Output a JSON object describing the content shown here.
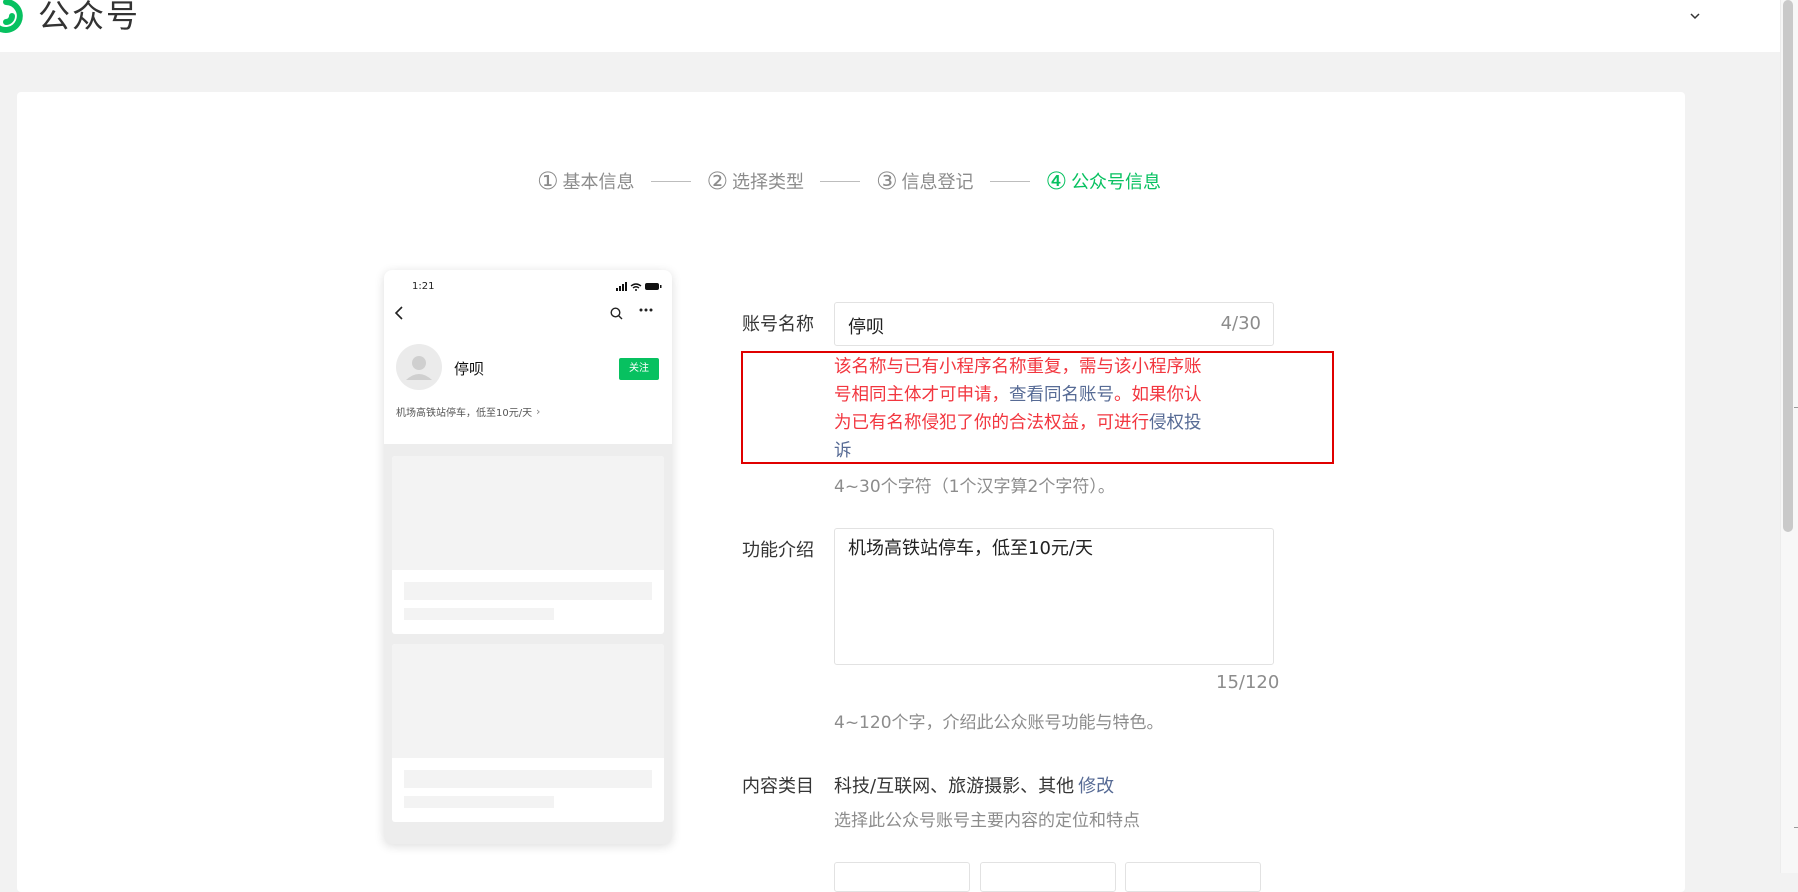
{
  "header": {
    "title": "公众号",
    "brand_color": "#07c160",
    "logo_icon": "wechat-official-account-logo",
    "account_menu_icon": "chevron-down-icon"
  },
  "steps": [
    {
      "num": "①",
      "label": "基本信息",
      "state": "done"
    },
    {
      "num": "②",
      "label": "选择类型",
      "state": "done"
    },
    {
      "num": "③",
      "label": "信息登记",
      "state": "done"
    },
    {
      "num": "④",
      "label": "公众号信息",
      "state": "active"
    }
  ],
  "preview": {
    "time": "1:21",
    "name": "停呗",
    "follow_label": "关注",
    "description": "机场高铁站停车，低至10元/天",
    "arrow": "›"
  },
  "form": {
    "name": {
      "label": "账号名称",
      "value": "停呗",
      "count": "4/30",
      "error": {
        "part1": "该名称与已有小程序名称重复，需与该小程序账号相同主体才可申请，",
        "link1": "查看同名账号",
        "part2": "。如果你认为已有名称侵犯了你的合法权益，可进行",
        "link2": "侵权投诉"
      },
      "hint": "4~30个字符（1个汉字算2个字符）。"
    },
    "intro": {
      "label": "功能介绍",
      "value": "机场高铁站停车，低至10元/天",
      "count": "15/120",
      "hint": "4~120个字，介绍此公众账号功能与特色。"
    },
    "category": {
      "label": "内容类目",
      "value": "科技/互联网、旅游摄影、其他",
      "edit_label": "修改",
      "hint": "选择此公众号账号主要内容的定位和特点"
    }
  },
  "colors": {
    "error": "#f2363f",
    "link": "#576b95",
    "highlight_border": "#e00000"
  }
}
